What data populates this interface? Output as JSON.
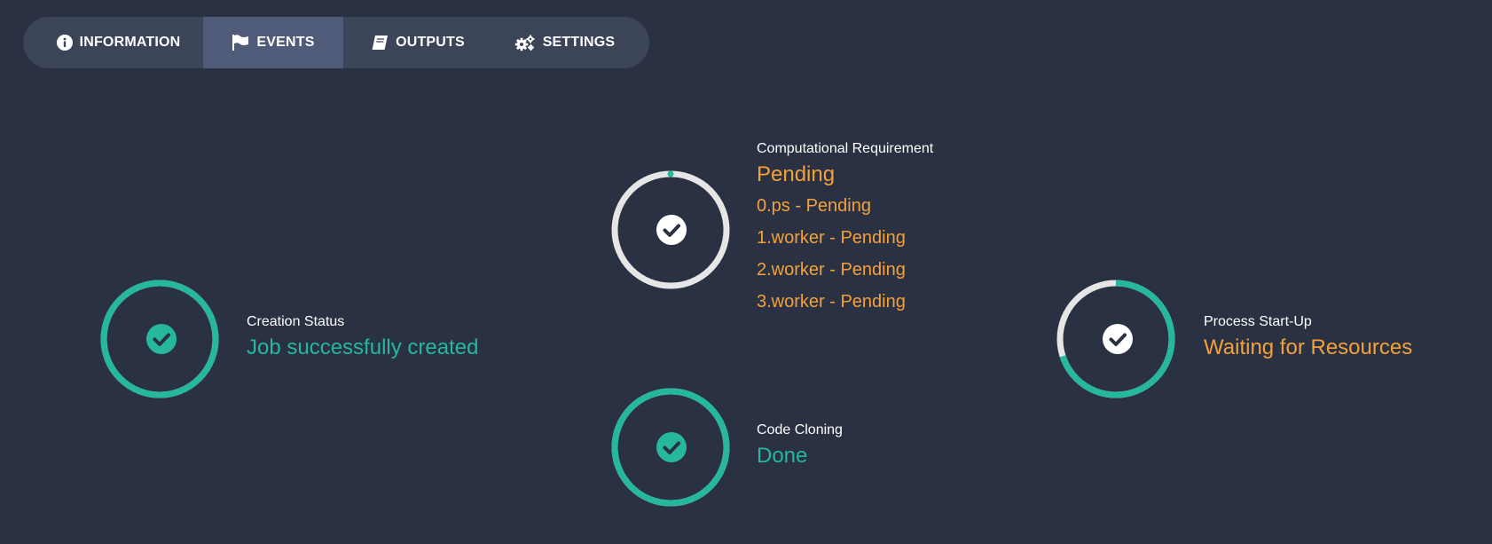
{
  "tabs": [
    {
      "label": "INFORMATION",
      "icon": "info-icon"
    },
    {
      "label": "EVENTS",
      "icon": "flag-icon",
      "active": true
    },
    {
      "label": "OUTPUTS",
      "icon": "book-icon"
    },
    {
      "label": "SETTINGS",
      "icon": "gears-icon"
    }
  ],
  "events": {
    "creation": {
      "label": "Creation Status",
      "status": "Job successfully created",
      "color": "#25b89c",
      "progress": 1.0
    },
    "computational": {
      "label": "Computational Requirement",
      "status": "Pending",
      "color": "#f4a13a",
      "progress": 0.0,
      "items": [
        "0.ps - Pending",
        "1.worker - Pending",
        "2.worker - Pending",
        "3.worker - Pending"
      ]
    },
    "code_cloning": {
      "label": "Code Cloning",
      "status": "Done",
      "color": "#25b89c",
      "progress": 1.0
    },
    "startup": {
      "label": "Process Start-Up",
      "status": "Waiting for Resources",
      "color": "#f4a13a",
      "progress": 0.7
    }
  },
  "colors": {
    "background": "#2a3142",
    "tabbar": "#3c4457",
    "tab_active": "#4f5b78",
    "ring_track": "#e6e6e6",
    "green": "#25b89c",
    "orange": "#f4a13a"
  }
}
